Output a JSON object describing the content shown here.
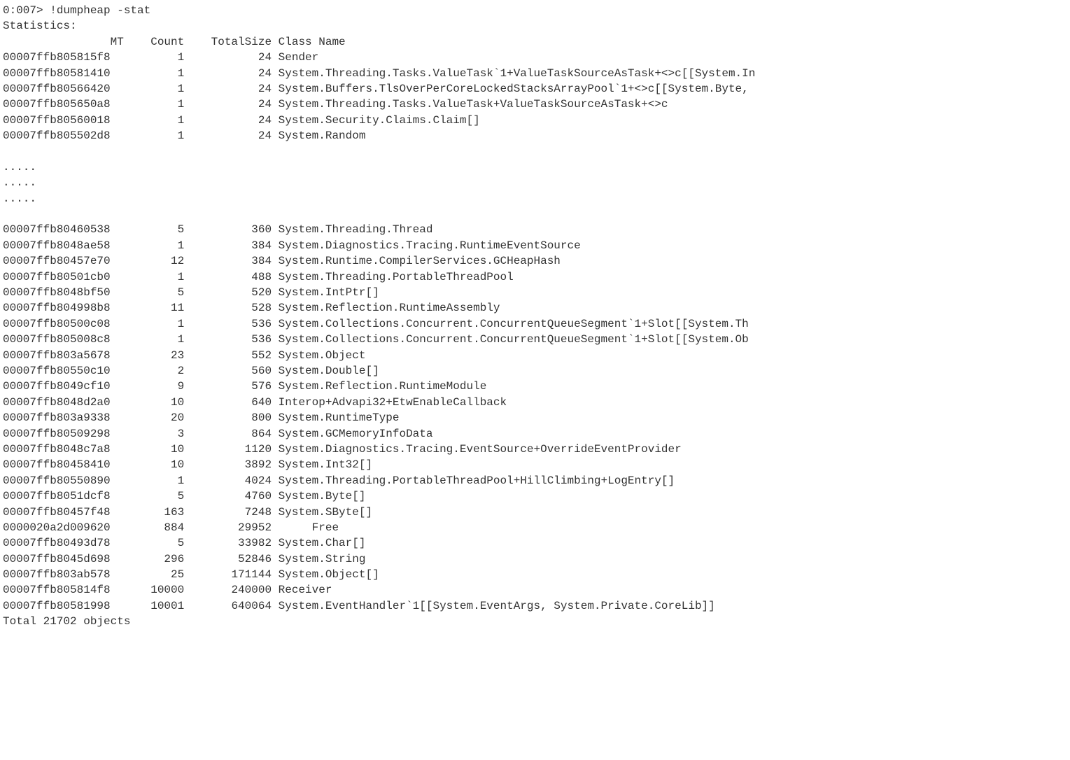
{
  "prompt": "0:007> !dumpheap -stat",
  "stats_label": "Statistics:",
  "headers": {
    "mt": "MT",
    "count": "Count",
    "total_size": "TotalSize",
    "class_name": "Class Name"
  },
  "ellipsis": ".....",
  "rows_top": [
    {
      "mt": "00007ffb805815f8",
      "count": "1",
      "size": "24",
      "cls": "Sender",
      "free": false
    },
    {
      "mt": "00007ffb80581410",
      "count": "1",
      "size": "24",
      "cls": "System.Threading.Tasks.ValueTask`1+ValueTaskSourceAsTask+<>c[[System.In",
      "free": false
    },
    {
      "mt": "00007ffb80566420",
      "count": "1",
      "size": "24",
      "cls": "System.Buffers.TlsOverPerCoreLockedStacksArrayPool`1+<>c[[System.Byte,",
      "free": false
    },
    {
      "mt": "00007ffb805650a8",
      "count": "1",
      "size": "24",
      "cls": "System.Threading.Tasks.ValueTask+ValueTaskSourceAsTask+<>c",
      "free": false
    },
    {
      "mt": "00007ffb80560018",
      "count": "1",
      "size": "24",
      "cls": "System.Security.Claims.Claim[]",
      "free": false
    },
    {
      "mt": "00007ffb805502d8",
      "count": "1",
      "size": "24",
      "cls": "System.Random",
      "free": false
    }
  ],
  "rows_bottom": [
    {
      "mt": "00007ffb80460538",
      "count": "5",
      "size": "360",
      "cls": "System.Threading.Thread",
      "free": false
    },
    {
      "mt": "00007ffb8048ae58",
      "count": "1",
      "size": "384",
      "cls": "System.Diagnostics.Tracing.RuntimeEventSource",
      "free": false
    },
    {
      "mt": "00007ffb80457e70",
      "count": "12",
      "size": "384",
      "cls": "System.Runtime.CompilerServices.GCHeapHash",
      "free": false
    },
    {
      "mt": "00007ffb80501cb0",
      "count": "1",
      "size": "488",
      "cls": "System.Threading.PortableThreadPool",
      "free": false
    },
    {
      "mt": "00007ffb8048bf50",
      "count": "5",
      "size": "520",
      "cls": "System.IntPtr[]",
      "free": false
    },
    {
      "mt": "00007ffb804998b8",
      "count": "11",
      "size": "528",
      "cls": "System.Reflection.RuntimeAssembly",
      "free": false
    },
    {
      "mt": "00007ffb80500c08",
      "count": "1",
      "size": "536",
      "cls": "System.Collections.Concurrent.ConcurrentQueueSegment`1+Slot[[System.Th",
      "free": false
    },
    {
      "mt": "00007ffb805008c8",
      "count": "1",
      "size": "536",
      "cls": "System.Collections.Concurrent.ConcurrentQueueSegment`1+Slot[[System.Ob",
      "free": false
    },
    {
      "mt": "00007ffb803a5678",
      "count": "23",
      "size": "552",
      "cls": "System.Object",
      "free": false
    },
    {
      "mt": "00007ffb80550c10",
      "count": "2",
      "size": "560",
      "cls": "System.Double[]",
      "free": false
    },
    {
      "mt": "00007ffb8049cf10",
      "count": "9",
      "size": "576",
      "cls": "System.Reflection.RuntimeModule",
      "free": false
    },
    {
      "mt": "00007ffb8048d2a0",
      "count": "10",
      "size": "640",
      "cls": "Interop+Advapi32+EtwEnableCallback",
      "free": false
    },
    {
      "mt": "00007ffb803a9338",
      "count": "20",
      "size": "800",
      "cls": "System.RuntimeType",
      "free": false
    },
    {
      "mt": "00007ffb80509298",
      "count": "3",
      "size": "864",
      "cls": "System.GCMemoryInfoData",
      "free": false
    },
    {
      "mt": "00007ffb8048c7a8",
      "count": "10",
      "size": "1120",
      "cls": "System.Diagnostics.Tracing.EventSource+OverrideEventProvider",
      "free": false
    },
    {
      "mt": "00007ffb80458410",
      "count": "10",
      "size": "3892",
      "cls": "System.Int32[]",
      "free": false
    },
    {
      "mt": "00007ffb80550890",
      "count": "1",
      "size": "4024",
      "cls": "System.Threading.PortableThreadPool+HillClimbing+LogEntry[]",
      "free": false
    },
    {
      "mt": "00007ffb8051dcf8",
      "count": "5",
      "size": "4760",
      "cls": "System.Byte[]",
      "free": false
    },
    {
      "mt": "00007ffb80457f48",
      "count": "163",
      "size": "7248",
      "cls": "System.SByte[]",
      "free": false
    },
    {
      "mt": "0000020a2d009620",
      "count": "884",
      "size": "29952",
      "cls": "Free",
      "free": true
    },
    {
      "mt": "00007ffb80493d78",
      "count": "5",
      "size": "33982",
      "cls": "System.Char[]",
      "free": false
    },
    {
      "mt": "00007ffb8045d698",
      "count": "296",
      "size": "52846",
      "cls": "System.String",
      "free": false
    },
    {
      "mt": "00007ffb803ab578",
      "count": "25",
      "size": "171144",
      "cls": "System.Object[]",
      "free": false
    },
    {
      "mt": "00007ffb805814f8",
      "count": "10000",
      "size": "240000",
      "cls": "Receiver",
      "free": false
    },
    {
      "mt": "00007ffb80581998",
      "count": "10001",
      "size": "640064",
      "cls": "System.EventHandler`1[[System.EventArgs, System.Private.CoreLib]]",
      "free": false
    }
  ],
  "total": "Total 21702 objects"
}
